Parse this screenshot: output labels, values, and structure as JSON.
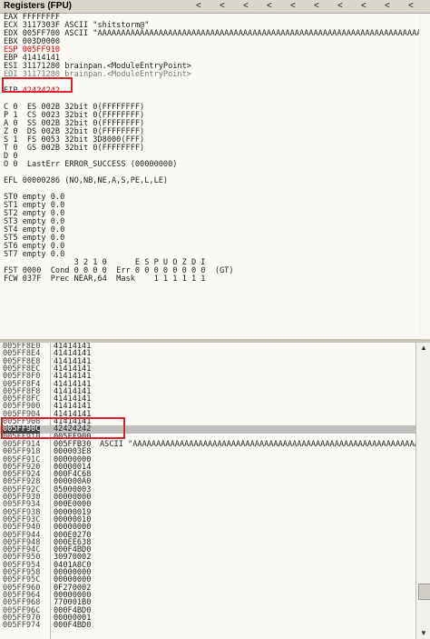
{
  "registers_title": "Registers (FPU)",
  "nav_arrows": [
    "<",
    "<",
    "<",
    "<",
    "<",
    "<",
    "<",
    "<",
    "<",
    "<"
  ],
  "reg_lines": [
    {
      "text": "EAX FFFFFFFF",
      "cls": ""
    },
    {
      "text": "ECX 3117303F ASCII \"shitstorm@\"",
      "cls": ""
    },
    {
      "text": "EDX 005FF700 ASCII \"AAAAAAAAAAAAAAAAAAAAAAAAAAAAAAAAAAAAAAAAAAAAAAAAAAAAAAAAAAAAAAAAAAAAAAA",
      "cls": ""
    },
    {
      "text": "EBX 003D0000",
      "cls": ""
    },
    {
      "text": "ESP 005FF910",
      "cls": "red"
    },
    {
      "text": "EBP 41414141",
      "cls": ""
    },
    {
      "text": "ESI 31171280 brainpan.<ModuleEntryPoint>",
      "cls": ""
    },
    {
      "text": "EDI 31171280 brainpan.<ModuleEntryPoint>",
      "cls": "grey"
    },
    {
      "text": "",
      "cls": ""
    },
    {
      "text": "EIP 42424242",
      "cls": "eip"
    },
    {
      "text": "",
      "cls": ""
    },
    {
      "text": "C 0  ES 002B 32bit 0(FFFFFFFF)",
      "cls": ""
    },
    {
      "text": "P 1  CS 0023 32bit 0(FFFFFFFF)",
      "cls": ""
    },
    {
      "text": "A 0  SS 002B 32bit 0(FFFFFFFF)",
      "cls": ""
    },
    {
      "text": "Z 0  DS 002B 32bit 0(FFFFFFFF)",
      "cls": ""
    },
    {
      "text": "S 1  FS 0053 32bit 3D8000(FFF)",
      "cls": ""
    },
    {
      "text": "T 0  GS 002B 32bit 0(FFFFFFFF)",
      "cls": ""
    },
    {
      "text": "D 0",
      "cls": ""
    },
    {
      "text": "O 0  LastErr ERROR_SUCCESS (00000000)",
      "cls": ""
    },
    {
      "text": "",
      "cls": ""
    },
    {
      "text": "EFL 00000286 (NO,NB,NE,A,S,PE,L,LE)",
      "cls": ""
    },
    {
      "text": "",
      "cls": ""
    },
    {
      "text": "ST0 empty 0.0",
      "cls": ""
    },
    {
      "text": "ST1 empty 0.0",
      "cls": ""
    },
    {
      "text": "ST2 empty 0.0",
      "cls": ""
    },
    {
      "text": "ST3 empty 0.0",
      "cls": ""
    },
    {
      "text": "ST4 empty 0.0",
      "cls": ""
    },
    {
      "text": "ST5 empty 0.0",
      "cls": ""
    },
    {
      "text": "ST6 empty 0.0",
      "cls": ""
    },
    {
      "text": "ST7 empty 0.0",
      "cls": ""
    },
    {
      "text": "               3 2 1 0      E S P U O Z D I",
      "cls": ""
    },
    {
      "text": "FST 0000  Cond 0 0 0 0  Err 0 0 0 0 0 0 0 0  (GT)",
      "cls": ""
    },
    {
      "text": "FCW 037F  Prec NEAR,64  Mask    1 1 1 1 1 1",
      "cls": ""
    }
  ],
  "stack_rows": [
    {
      "addr": "005FF8E0",
      "val": "41414141",
      "comment": ""
    },
    {
      "addr": "005FF8E4",
      "val": "41414141",
      "comment": ""
    },
    {
      "addr": "005FF8E8",
      "val": "41414141",
      "comment": ""
    },
    {
      "addr": "005FF8EC",
      "val": "41414141",
      "comment": ""
    },
    {
      "addr": "005FF8F0",
      "val": "41414141",
      "comment": ""
    },
    {
      "addr": "005FF8F4",
      "val": "41414141",
      "comment": ""
    },
    {
      "addr": "005FF8F8",
      "val": "41414141",
      "comment": ""
    },
    {
      "addr": "005FF8FC",
      "val": "41414141",
      "comment": ""
    },
    {
      "addr": "005FF900",
      "val": "41414141",
      "comment": ""
    },
    {
      "addr": "005FF904",
      "val": "41414141",
      "comment": ""
    },
    {
      "addr": "005FF908",
      "val": "41414141",
      "comment": ""
    },
    {
      "addr": "005FF90C",
      "val": "42424242",
      "comment": "",
      "hl": true
    },
    {
      "addr": "005FF910",
      "val": "005FF900",
      "comment": ""
    },
    {
      "addr": "005FF914",
      "val": "005FFB30",
      "comment": "ASCII \"AAAAAAAAAAAAAAAAAAAAAAAAAAAAAAAAAAAAAAAAAAAAAAAAAAAAAAAAAAAAAAAAAA"
    },
    {
      "addr": "005FF918",
      "val": "000003E8",
      "comment": ""
    },
    {
      "addr": "005FF91C",
      "val": "00000000",
      "comment": ""
    },
    {
      "addr": "005FF920",
      "val": "00000014",
      "comment": ""
    },
    {
      "addr": "005FF924",
      "val": "000F4C68",
      "comment": ""
    },
    {
      "addr": "005FF928",
      "val": "000000A0",
      "comment": ""
    },
    {
      "addr": "005FF92C",
      "val": "05000003",
      "comment": ""
    },
    {
      "addr": "005FF930",
      "val": "00000000",
      "comment": ""
    },
    {
      "addr": "005FF934",
      "val": "000E0000",
      "comment": ""
    },
    {
      "addr": "005FF938",
      "val": "00000019",
      "comment": ""
    },
    {
      "addr": "005FF93C",
      "val": "00000010",
      "comment": ""
    },
    {
      "addr": "005FF940",
      "val": "00000000",
      "comment": ""
    },
    {
      "addr": "005FF944",
      "val": "000E0270",
      "comment": ""
    },
    {
      "addr": "005FF948",
      "val": "000EE638",
      "comment": ""
    },
    {
      "addr": "005FF94C",
      "val": "000F4BD0",
      "comment": ""
    },
    {
      "addr": "005FF950",
      "val": "30970002",
      "comment": ""
    },
    {
      "addr": "005FF954",
      "val": "0401A8C0",
      "comment": ""
    },
    {
      "addr": "005FF958",
      "val": "00000000",
      "comment": ""
    },
    {
      "addr": "005FF95C",
      "val": "00000000",
      "comment": ""
    },
    {
      "addr": "005FF960",
      "val": "0F270002",
      "comment": ""
    },
    {
      "addr": "005FF964",
      "val": "00000000",
      "comment": ""
    },
    {
      "addr": "005FF968",
      "val": "770001B0",
      "comment": ""
    },
    {
      "addr": "005FF96C",
      "val": "000F4BD0",
      "comment": ""
    },
    {
      "addr": "005FF970",
      "val": "00000001",
      "comment": ""
    },
    {
      "addr": "005FF974",
      "val": "000F4BD0",
      "comment": ""
    }
  ],
  "scroll_up_glyph": "▲",
  "scroll_down_glyph": "▼"
}
